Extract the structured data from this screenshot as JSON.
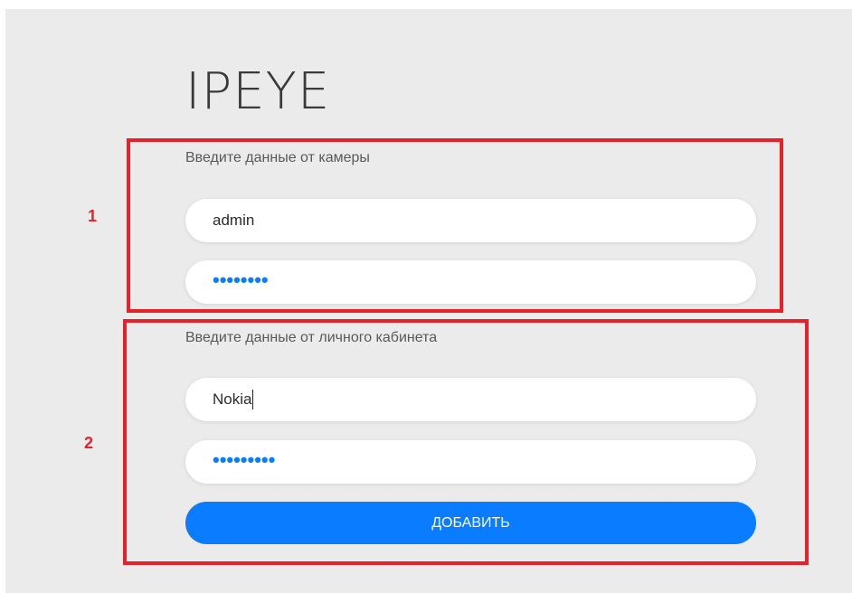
{
  "app": {
    "logo_text": "IPEYE"
  },
  "camera_section": {
    "label": "Введите данные от камеры",
    "login_value": "admin",
    "password_value": "••••••••"
  },
  "account_section": {
    "label": "Введите данные от личного кабинета",
    "login_value": "Nokia",
    "password_value": "•••••••••"
  },
  "actions": {
    "add_label": "ДОБАВИТЬ"
  },
  "annotations": {
    "box_1_number": "1",
    "box_2_number": "2",
    "color": "#e8202a"
  },
  "colors": {
    "accent": "#0a7cff",
    "background": "#ebebeb"
  }
}
